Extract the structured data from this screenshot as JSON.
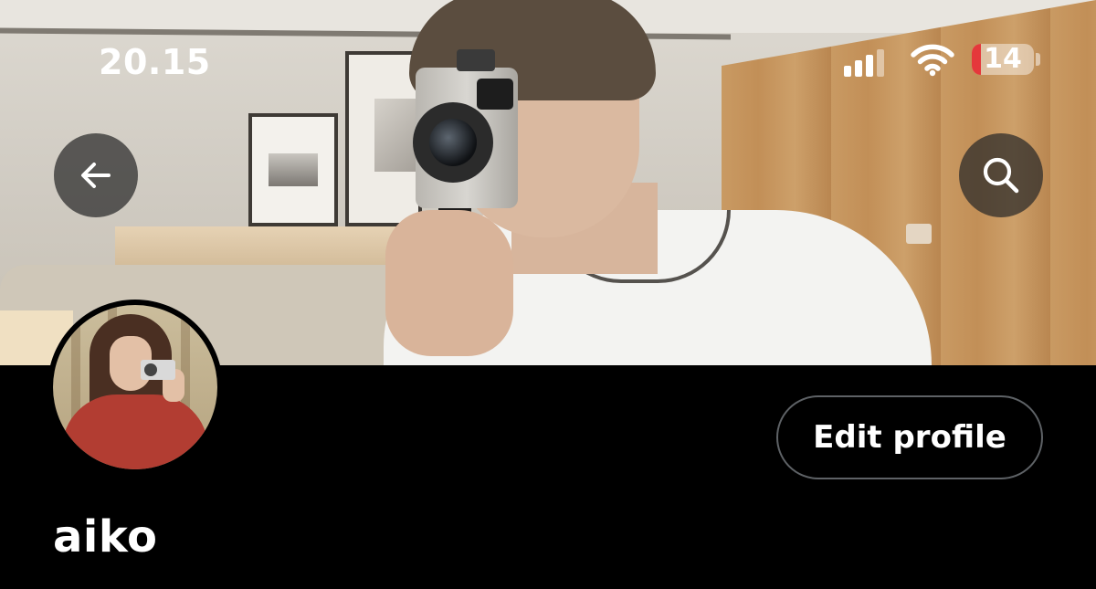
{
  "status_bar": {
    "time": "20.15",
    "battery_level": "14",
    "battery_fraction": 0.14,
    "battery_color": "#e5383b",
    "signal_icon": "cellular-signal-icon",
    "wifi_icon": "wifi-icon"
  },
  "header": {
    "back_icon": "arrow-left-icon",
    "search_icon": "search-icon"
  },
  "profile": {
    "display_name": "aiko",
    "edit_label": "Edit profile"
  },
  "colors": {
    "background": "#000000",
    "button_border": "#5e6266"
  }
}
